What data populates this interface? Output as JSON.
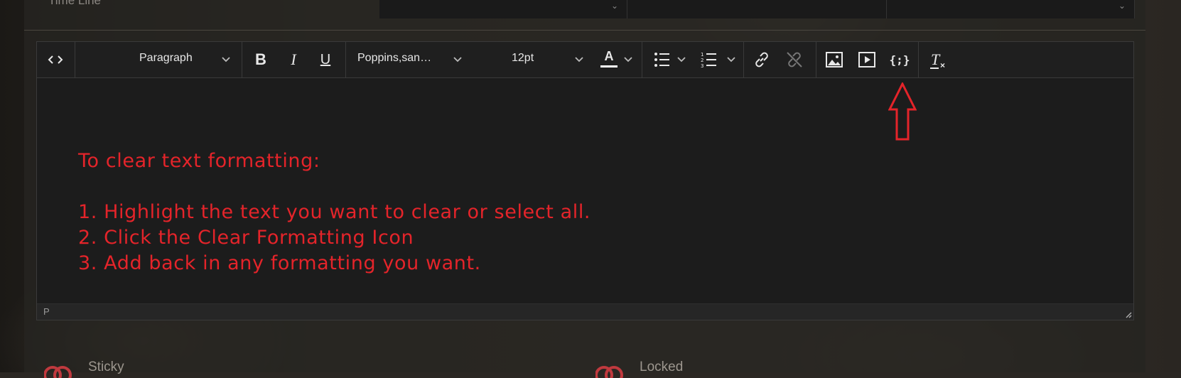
{
  "top": {
    "field_label": "Time Line"
  },
  "toolbar": {
    "source_code": "source-code",
    "block_format": "Paragraph",
    "bold": "B",
    "italic": "I",
    "underline": "U",
    "font_family": "Poppins,san…",
    "font_size": "12pt",
    "text_color_glyph": "A",
    "bullet_list": "bullet-list",
    "numbered_list": "numbered-list",
    "link": "link",
    "unlink": "unlink",
    "image": "image",
    "media": "media",
    "code_sample": "{;}",
    "clear_formatting_glyph": "T"
  },
  "content": {
    "line1": "To clear text formatting:",
    "line2": "1. Highlight the text you want to clear or select all.",
    "line3": "2. Click the Clear Formatting Icon",
    "line4": "3. Add back in any formatting you want."
  },
  "statusbar": {
    "path": "P"
  },
  "toggles": [
    {
      "label": "Sticky"
    },
    {
      "label": "Locked"
    }
  ],
  "colors": {
    "annotation_red": "#e4242a",
    "text_color_underline": "#ffffff"
  }
}
